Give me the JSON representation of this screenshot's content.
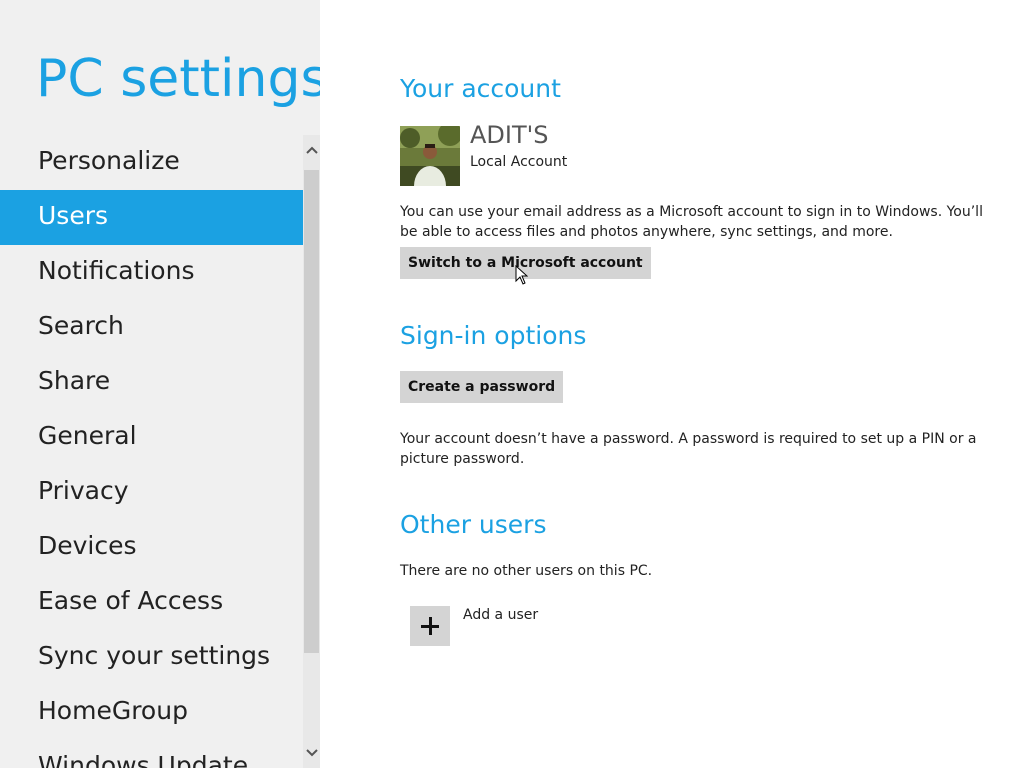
{
  "app": {
    "title": "PC settings"
  },
  "sidebar": {
    "items": [
      {
        "label": "Personalize"
      },
      {
        "label": "Users"
      },
      {
        "label": "Notifications"
      },
      {
        "label": "Search"
      },
      {
        "label": "Share"
      },
      {
        "label": "General"
      },
      {
        "label": "Privacy"
      },
      {
        "label": "Devices"
      },
      {
        "label": "Ease of Access"
      },
      {
        "label": "Sync your settings"
      },
      {
        "label": "HomeGroup"
      },
      {
        "label": "Windows Update"
      }
    ],
    "selected": "Users"
  },
  "account": {
    "section_title": "Your account",
    "name": "ADIT'S",
    "type": "Local Account",
    "description": "You can use your email address as a Microsoft account to sign in to Windows. You’ll be able to access files and photos anywhere, sync settings, and more.",
    "switch_button": "Switch to a Microsoft account"
  },
  "signin": {
    "section_title": "Sign-in options",
    "create_password_button": "Create a password",
    "description": "Your account doesn’t have a password. A password is required to set up a PIN or a picture password."
  },
  "other_users": {
    "section_title": "Other users",
    "description": "There are no other users on this PC.",
    "add_user_label": "Add a user"
  },
  "icons": {
    "scroll_up": "chevron-up-icon",
    "scroll_down": "chevron-down-icon",
    "add": "plus-icon",
    "pointer": "mouse-pointer-icon"
  },
  "colors": {
    "accent": "#1ba1e2",
    "sidebar_bg": "#f0f0f0",
    "button_bg": "#d4d4d4"
  }
}
